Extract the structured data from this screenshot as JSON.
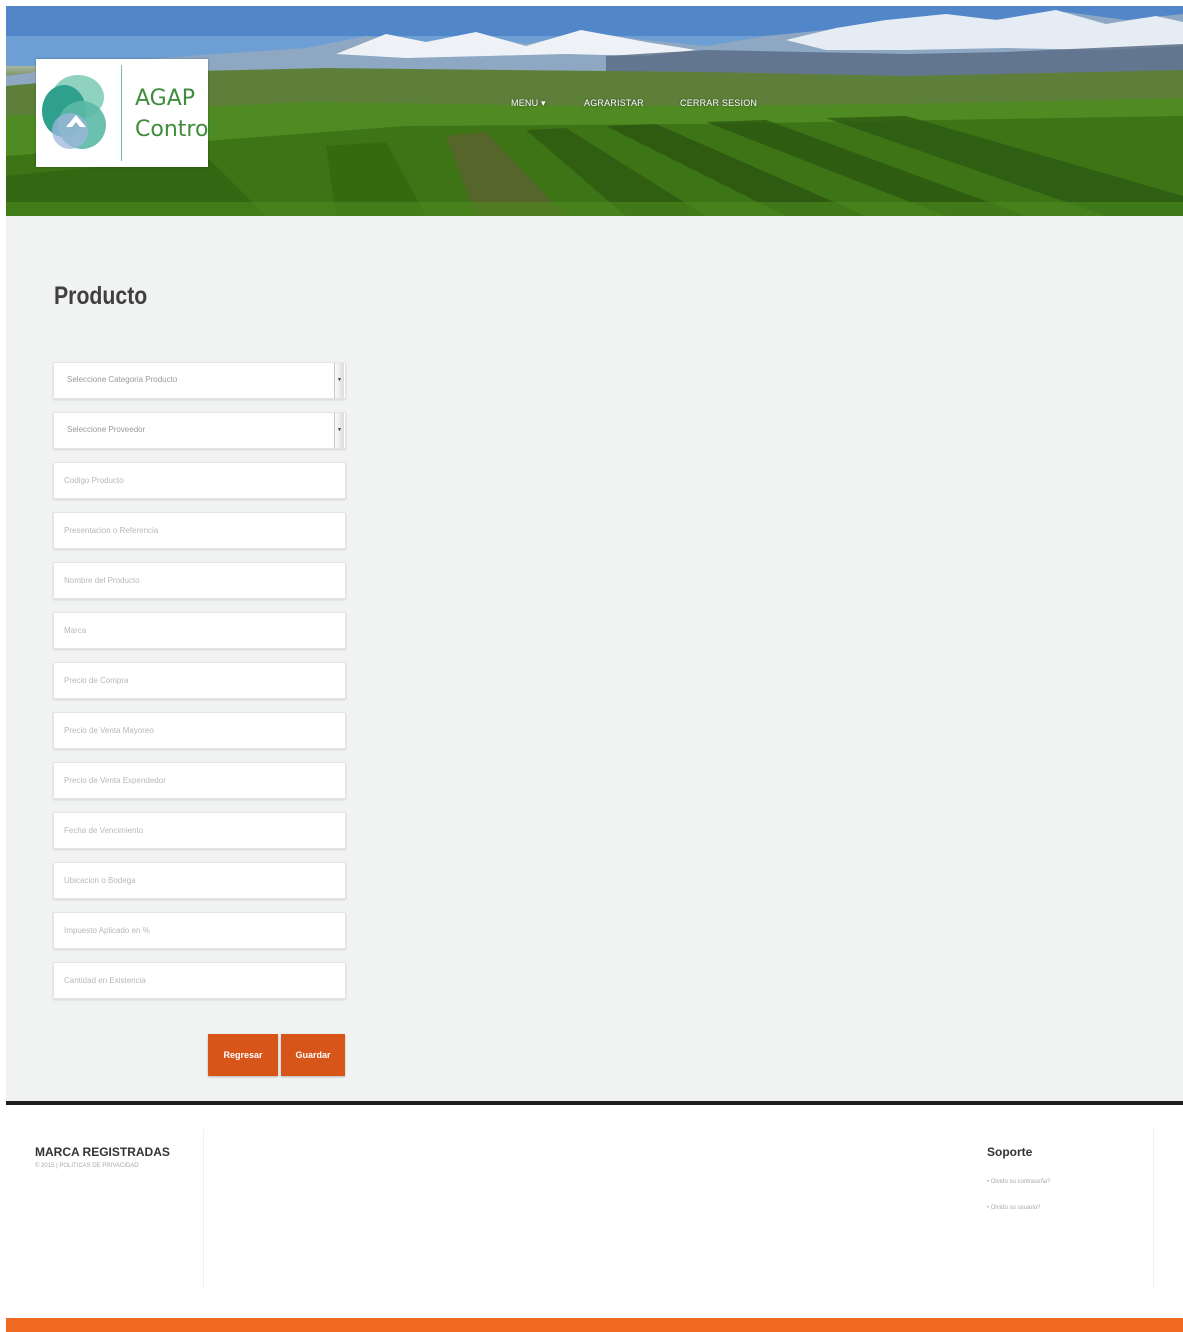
{
  "header": {
    "logo_line1": "AGAP",
    "logo_line2": "Control",
    "nav": [
      {
        "label": "MENU ▾"
      },
      {
        "label": "AGRARISTAR"
      },
      {
        "label": "CERRAR SESION"
      }
    ]
  },
  "main": {
    "title": "Producto",
    "selects": [
      {
        "selected": "Seleccione Categoria Producto"
      },
      {
        "selected": "Seleccione Proveedor"
      }
    ],
    "inputs": [
      {
        "placeholder": "Codigo Producto"
      },
      {
        "placeholder": "Presentacion o Referencia"
      },
      {
        "placeholder": "Nombre del Producto"
      },
      {
        "placeholder": "Marca"
      },
      {
        "placeholder": "Precio de Compra"
      },
      {
        "placeholder": "Precio de Venta Mayoreo"
      },
      {
        "placeholder": "Precio de Venta Expendedor"
      },
      {
        "placeholder": "Fecha de Vencimiento"
      },
      {
        "placeholder": "Ubicacion o Bodega"
      },
      {
        "placeholder": "Impuesto Aplicado en %"
      },
      {
        "placeholder": "Cantidad en Existencia"
      }
    ],
    "buttons": {
      "back": "Regresar",
      "save": "Guardar"
    }
  },
  "footer": {
    "brand_heading": "MARCA REGISTRADAS",
    "brand_sub": "© 2015 | POLITICAS DE PRIVACIDAD",
    "support_heading": "Soporte",
    "support_links": [
      {
        "label": "• Olvido su contraseña?"
      },
      {
        "label": "• Olvido su usuario?"
      }
    ]
  },
  "colors": {
    "accent": "#d8551a",
    "footer_bar": "#ef6a1e",
    "footer_line": "#1e1e1e",
    "logo_text": "#3f8d3c",
    "content_bg": "#f1f2f2"
  }
}
